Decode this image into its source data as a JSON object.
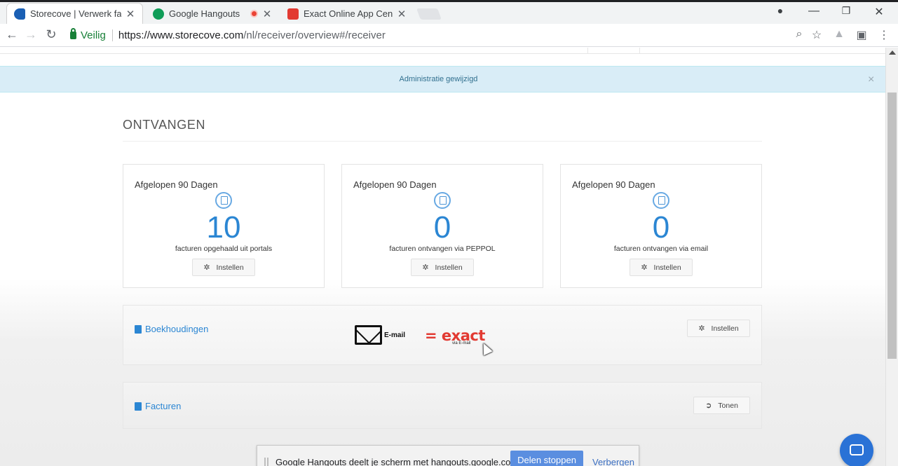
{
  "browser": {
    "tabs": [
      {
        "title": "Storecove | Verwerk factu",
        "active": true,
        "favicon_color": "#1a5fb4"
      },
      {
        "title": "Google Hangouts",
        "active": false,
        "favicon_color": "#0f9d58"
      },
      {
        "title": "Exact Online App Center",
        "active": false,
        "favicon_color": "#e23a32"
      }
    ],
    "window_controls": {
      "minimize": "—",
      "restore": "❐",
      "close": "✕"
    },
    "security_label": "Veilig",
    "url_host": "https://www.storecove.com",
    "url_path": "/nl/receiver/overview#/receiver"
  },
  "alert": {
    "message": "Administratie gewijzigd",
    "close": "×"
  },
  "section": {
    "title": "ONTVANGEN"
  },
  "stats": [
    {
      "heading": "Afgelopen 90 Dagen",
      "count": "10",
      "caption": "facturen opgehaald uit portals",
      "button": "Instellen"
    },
    {
      "heading": "Afgelopen 90 Dagen",
      "count": "0",
      "caption": "facturen ontvangen via PEPPOL",
      "button": "Instellen"
    },
    {
      "heading": "Afgelopen 90 Dagen",
      "count": "0",
      "caption": "facturen ontvangen via email",
      "button": "Instellen"
    }
  ],
  "boekhoudingen": {
    "title": "Boekhoudingen",
    "email_label": "E-mail",
    "exact_word": "= exact",
    "exact_sub": "via E-mail",
    "button": "Instellen"
  },
  "facturen": {
    "title": "Facturen",
    "button": "Tonen"
  },
  "sharebar": {
    "text": "Google Hangouts deelt je scherm met hangouts.google.com.",
    "stop": "Delen stoppen",
    "hide": "Verbergen"
  },
  "colors": {
    "accent": "#2b86d3",
    "alert_bg": "#d9edf7",
    "exact_red": "#e23a32"
  }
}
